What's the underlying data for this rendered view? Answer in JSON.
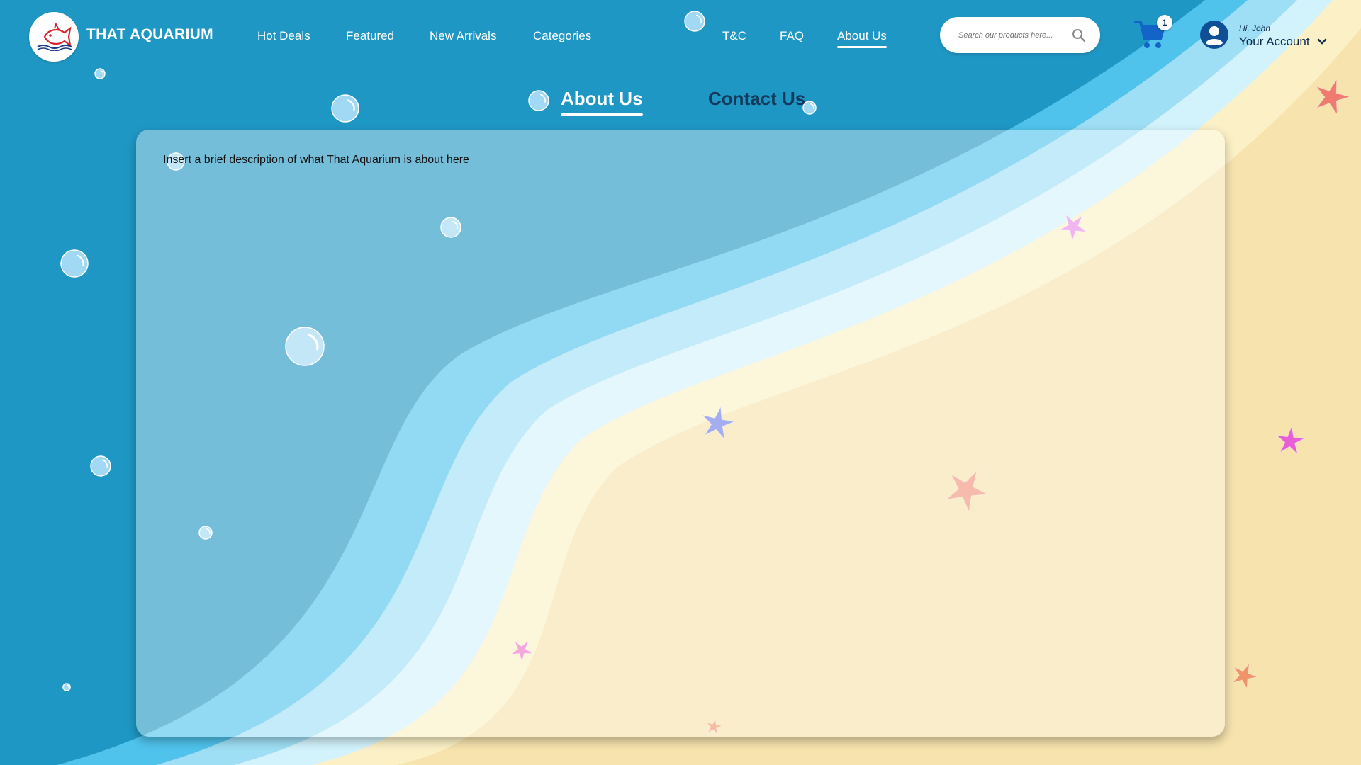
{
  "brand": {
    "name": "THAT AQUARIUM"
  },
  "nav": {
    "left_items": [
      "Hot Deals",
      "Featured",
      "New Arrivals",
      "Categories"
    ],
    "right_items": [
      "T&C",
      "FAQ",
      "About Us"
    ],
    "active": "About Us"
  },
  "search": {
    "placeholder": "Search our products here..."
  },
  "cart": {
    "count": "1"
  },
  "account": {
    "greeting": "Hi, John",
    "label": "Your Account"
  },
  "tabs": [
    {
      "label": "About Us",
      "active": true
    },
    {
      "label": "Contact Us",
      "active": false
    }
  ],
  "content": {
    "description": "Insert a brief description of what That Aquarium is about here"
  },
  "colors": {
    "ocean": "#1f97c4",
    "wave_light": "#4fc3ec",
    "foam": "#d3f3fc",
    "sand": "#f6e3ad",
    "navy": "#0f2b4d",
    "cart_blue": "#1265c6"
  },
  "icons": [
    "fish-logo-icon",
    "search-icon",
    "cart-icon",
    "user-icon",
    "chevron-down-icon",
    "bubble-icon",
    "starfish-icon"
  ]
}
